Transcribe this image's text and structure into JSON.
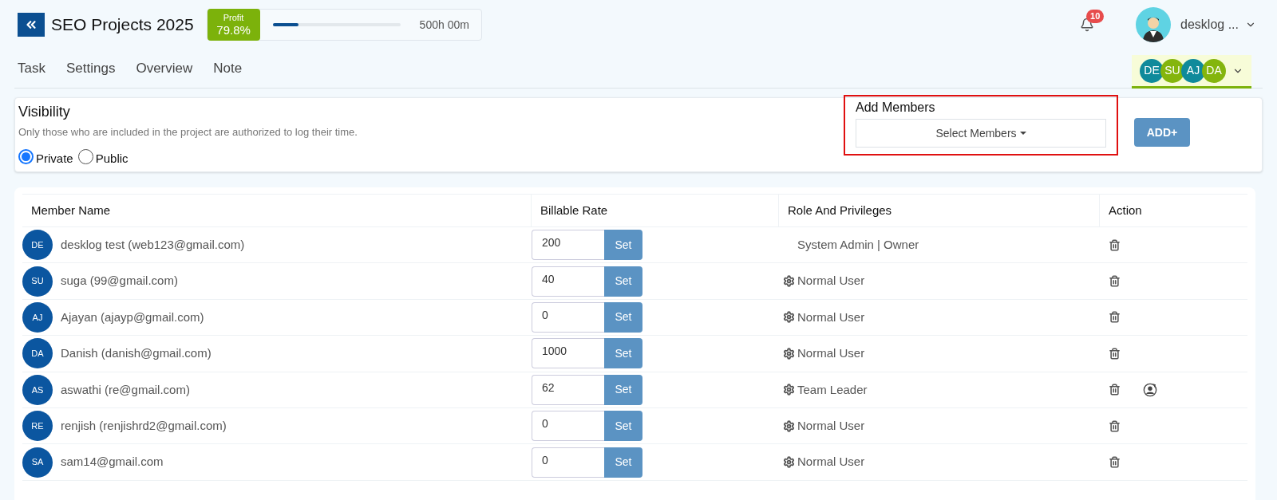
{
  "header": {
    "title": "SEO Projects 2025",
    "profit": {
      "label": "Profit",
      "value": "79.8%"
    },
    "progress": {
      "level": 0.2,
      "reading": "500h 00m"
    },
    "notifications": {
      "count": "10"
    },
    "user": {
      "name": "desklog ..."
    }
  },
  "tabs": [
    {
      "label": "Task"
    },
    {
      "label": "Settings"
    },
    {
      "label": "Overview"
    },
    {
      "label": "Note"
    }
  ],
  "member_avatars": [
    {
      "initials": "DE",
      "color": "#0f8a9b"
    },
    {
      "initials": "SU",
      "color": "#84b50d"
    },
    {
      "initials": "AJ",
      "color": "#0f8a9b"
    },
    {
      "initials": "DA",
      "color": "#84b50d"
    }
  ],
  "visibility": {
    "title": "Visibility",
    "description": "Only those who are included in the project are authorized to log their time.",
    "options": [
      {
        "label": "Private",
        "selected": true
      },
      {
        "label": "Public",
        "selected": false
      }
    ]
  },
  "add_members": {
    "title": "Add Members",
    "select": "Select Members",
    "button": "ADD+"
  },
  "table": {
    "columns": [
      "Member Name",
      "Billable Rate",
      "Role And Privileges",
      "Action"
    ],
    "rows": [
      {
        "initials": "DE",
        "name": "desklog test (web123@gmail.com)",
        "rate": "200",
        "set_label": "Set",
        "role": "System Admin | Owner",
        "role_editable": false,
        "actions": [
          {
            "kind": "delete"
          }
        ]
      },
      {
        "initials": "SU",
        "name": "suga (99@gmail.com)",
        "rate": "40",
        "set_label": "Set",
        "role": "Normal User",
        "role_editable": true,
        "actions": [
          {
            "kind": "delete"
          }
        ]
      },
      {
        "initials": "AJ",
        "name": "Ajayan (ajayp@gmail.com)",
        "rate": "0",
        "set_label": "Set",
        "role": "Normal User",
        "role_editable": true,
        "actions": [
          {
            "kind": "delete"
          }
        ]
      },
      {
        "initials": "DA",
        "name": "Danish (danish@gmail.com)",
        "rate": "1000",
        "set_label": "Set",
        "role": "Normal User",
        "role_editable": true,
        "actions": [
          {
            "kind": "delete"
          }
        ]
      },
      {
        "initials": "AS",
        "name": "aswathi (re@gmail.com)",
        "rate": "62",
        "set_label": "Set",
        "role": "Team Leader",
        "role_editable": true,
        "actions": [
          {
            "kind": "delete"
          },
          {
            "kind": "reassign"
          }
        ]
      },
      {
        "initials": "RE",
        "name": "renjish (renjishrd2@gmail.com)",
        "rate": "0",
        "set_label": "Set",
        "role": "Normal User",
        "role_editable": true,
        "actions": [
          {
            "kind": "delete"
          }
        ]
      },
      {
        "initials": "SA",
        "name": "sam14@gmail.com",
        "rate": "0",
        "set_label": "Set",
        "role": "Normal User",
        "role_editable": true,
        "actions": [
          {
            "kind": "delete"
          }
        ]
      }
    ]
  }
}
